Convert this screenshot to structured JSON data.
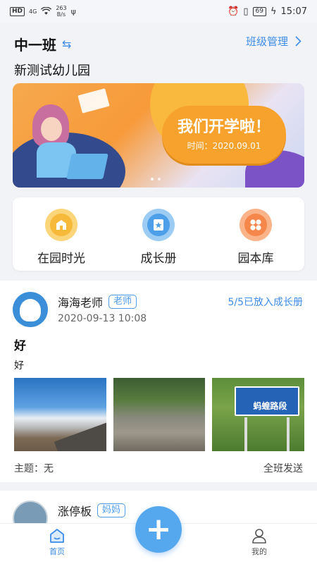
{
  "status_bar": {
    "hd": "HD",
    "signal": "4G",
    "net_speed_value": "263",
    "net_speed_unit": "B/s",
    "battery": "69",
    "time": "15:07"
  },
  "header": {
    "class_name": "中一班",
    "manage_label": "班级管理",
    "school_name": "新测试幼儿园"
  },
  "banner": {
    "headline": "我们开学啦！",
    "date_text": "时间：2020.09.01"
  },
  "quick_menu": [
    {
      "label": "在园时光",
      "icon": "school-icon"
    },
    {
      "label": "成长册",
      "icon": "album-icon"
    },
    {
      "label": "园本库",
      "icon": "library-icon"
    }
  ],
  "post": {
    "author": "海海老师",
    "role": "老师",
    "status": "5/5已放入成长册",
    "time": "2020-09-13 10:08",
    "title": "好",
    "body": "好",
    "sign_text": "蚂蝗路段",
    "topic": "主题：无",
    "scope": "全班发送"
  },
  "post2": {
    "author": "涨停板",
    "role": "妈妈"
  },
  "bottom_nav": {
    "home_label": "首页",
    "mine_label": "我的"
  },
  "colors": {
    "accent": "#3d8ce8",
    "background": "#f1f3f6"
  }
}
